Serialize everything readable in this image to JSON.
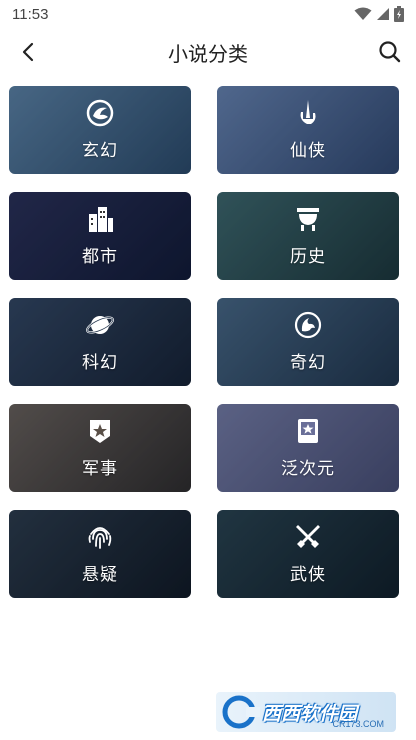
{
  "status": {
    "time": "11:53"
  },
  "header": {
    "title": "小说分类"
  },
  "categories": [
    {
      "label": "玄幻",
      "icon": "dragon-icon",
      "bg": [
        "#5f86a8",
        "#2b4a68"
      ]
    },
    {
      "label": "仙侠",
      "icon": "sword-hand-icon",
      "bg": [
        "#6b87b4",
        "#31486f"
      ]
    },
    {
      "label": "都市",
      "icon": "city-icon",
      "bg": [
        "#2a2e55",
        "#0f1630"
      ]
    },
    {
      "label": "历史",
      "icon": "cauldron-icon",
      "bg": [
        "#3f6a6c",
        "#1b3536"
      ]
    },
    {
      "label": "科幻",
      "icon": "planet-icon",
      "bg": [
        "#334660",
        "#141e2e"
      ]
    },
    {
      "label": "奇幻",
      "icon": "mythic-beast-icon",
      "bg": [
        "#4a6a86",
        "#1f3348"
      ]
    },
    {
      "label": "军事",
      "icon": "medal-star-icon",
      "bg": [
        "#6d6258",
        "#2f2a26"
      ]
    },
    {
      "label": "泛次元",
      "icon": "card-star-icon",
      "bg": [
        "#7a7fa8",
        "#4b4f74"
      ]
    },
    {
      "label": "悬疑",
      "icon": "fingerprint-icon",
      "bg": [
        "#2c3a48",
        "#0e151d"
      ]
    },
    {
      "label": "武侠",
      "icon": "crossed-swords-icon",
      "bg": [
        "#29424c",
        "#0e1b22"
      ]
    }
  ],
  "watermark": {
    "text": "西西软件园",
    "sub": "CR173.COM"
  }
}
